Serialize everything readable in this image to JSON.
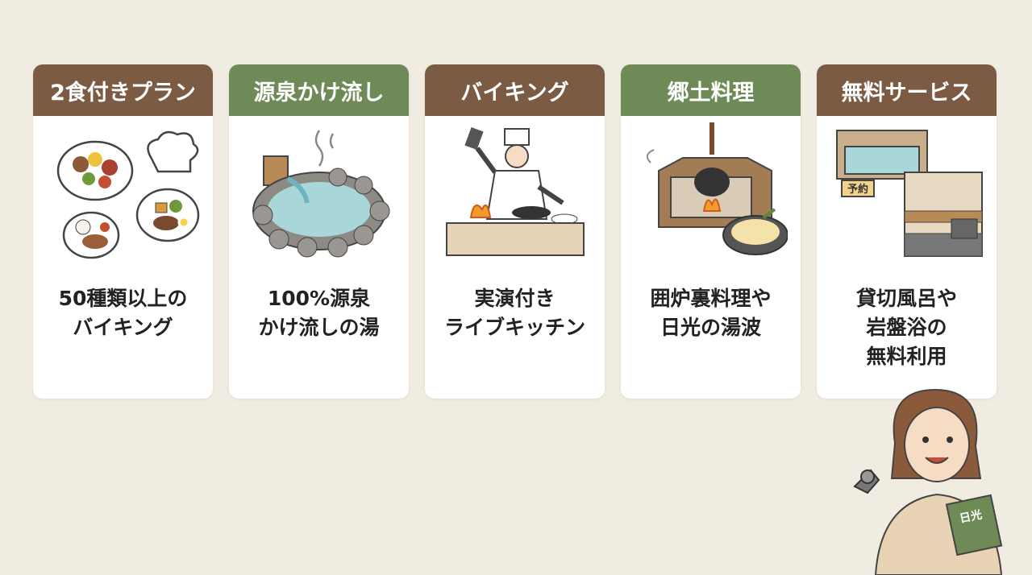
{
  "cards": [
    {
      "title": "2食付きプラン",
      "header_color": "#7b5b43",
      "illustration": "buffet-plates-chef-hat-icon",
      "lines": [
        "50種類以上の",
        "バイキング"
      ]
    },
    {
      "title": "源泉かけ流し",
      "header_color": "#6d8a57",
      "illustration": "hot-spring-pool-icon",
      "lines": [
        "100%源泉",
        "かけ流しの湯"
      ]
    },
    {
      "title": "バイキング",
      "header_color": "#7b5b43",
      "illustration": "chef-cooking-icon",
      "lines": [
        "実演付き",
        "ライブキッチン"
      ]
    },
    {
      "title": "郷土料理",
      "header_color": "#6d8a57",
      "illustration": "irori-hearth-yuba-icon",
      "lines": [
        "囲炉裏料理や",
        "日光の湯波"
      ]
    },
    {
      "title": "無料サービス",
      "header_color": "#7b5b43",
      "illustration": "private-bath-bedrock-bath-icon",
      "lines": [
        "貸切風呂や",
        "岩盤浴の",
        "無料利用"
      ]
    }
  ],
  "illustration_text": {
    "reserved_sign": "予約",
    "guidebook_title": "日光"
  },
  "colors": {
    "background": "#f1ece1",
    "brown": "#7b5b43",
    "green": "#6d8a57",
    "card": "#ffffff"
  }
}
